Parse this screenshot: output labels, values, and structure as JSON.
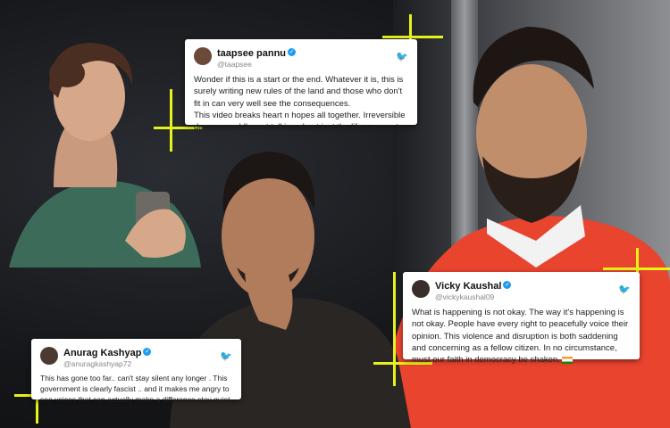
{
  "tweets": {
    "taapsee": {
      "name": "taapsee pannu",
      "handle": "@taapsee",
      "line1": "Wonder if this is a start or the end. Whatever it is, this is surely writing new rules of the land and those who don't fit in can very well see the consequences.",
      "line2": "This video breaks heart n hopes all together. Irreversible damage,and I'm not talking about just the life n property"
    },
    "vicky": {
      "name": "Vicky Kaushal",
      "handle": "@vickykaushal09",
      "text": "What is happening is not okay. The way it's happening is not okay. People have every right to peacefully voice their opinion. This violence and disruption is both saddening and concerning as a fellow citizen. In no circumstance, must our faith in democracy be shaken."
    },
    "anurag": {
      "name": "Anurag Kashyap",
      "handle": "@anuragkashyap72",
      "text": "This has gone too far.. can't stay silent any longer . This government is clearly fascist .. and it makes me angry to see voices that can actually make a difference stay quiet .."
    }
  },
  "icons": {
    "bird": "twitter-bird-icon",
    "verified": "verified-badge-icon",
    "flag": "india-flag-icon"
  },
  "colors": {
    "accent_cross": "#e6f21a",
    "twitter_blue": "#1d9bf0",
    "vicky_sweater": "#e8442e",
    "taapsee_sweater": "#3c6b5a"
  }
}
